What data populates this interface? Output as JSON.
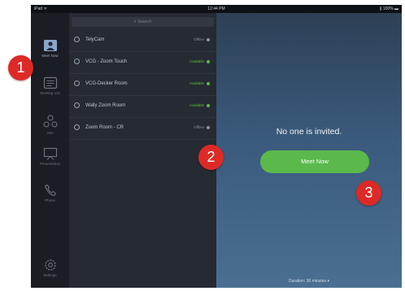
{
  "statusbar": {
    "carrier": "iPad ᯤ",
    "time": "12:44 PM",
    "battery": "∦ 100% ▬"
  },
  "rail": {
    "items": [
      {
        "label": "Meet Now",
        "icon": "meet-now-icon"
      },
      {
        "label": "Meeting List",
        "icon": "meeting-list-icon"
      },
      {
        "label": "Join",
        "icon": "join-icon"
      },
      {
        "label": "Presentation",
        "icon": "presentation-icon"
      },
      {
        "label": "Phone",
        "icon": "phone-icon"
      },
      {
        "label": "Settings",
        "icon": "settings-icon"
      }
    ]
  },
  "search": {
    "placeholder": "⌕ Search"
  },
  "rooms": [
    {
      "name": "TelyCam",
      "status": "Offline",
      "status_color": "#8e949c"
    },
    {
      "name": "VCG - Zoom Touch",
      "status": "Available",
      "status_color": "#55c23e"
    },
    {
      "name": "VCG-Decker Room",
      "status": "Available",
      "status_color": "#55c23e"
    },
    {
      "name": "Wally Zoom Room",
      "status": "Available",
      "status_color": "#55c23e"
    },
    {
      "name": "Zoom Room - CR",
      "status": "Offline",
      "status_color": "#8e949c"
    }
  ],
  "main": {
    "invite_status": "No one is invited.",
    "meet_now_label": "Meet Now",
    "duration": "Duration: 30 minutes ▾"
  },
  "callouts": [
    "1",
    "2",
    "3"
  ],
  "colors": {
    "callout": "#dd2a27",
    "meet_button": "#5ab94a",
    "available": "#55c23e",
    "offline": "#8e949c"
  }
}
